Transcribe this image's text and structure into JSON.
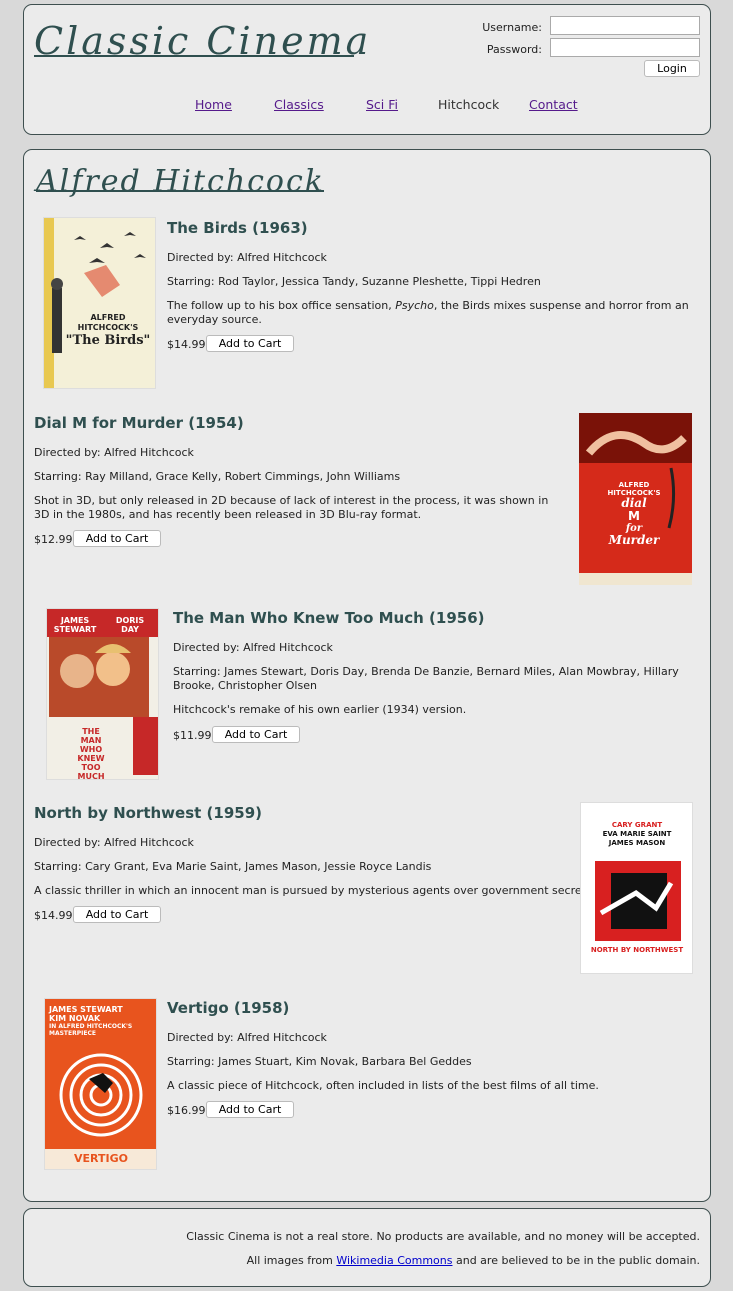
{
  "site": {
    "logo": "Classic Cinema"
  },
  "login": {
    "username_label": "Username:",
    "password_label": "Password:",
    "username_value": "",
    "password_value": "",
    "button": "Login"
  },
  "nav": {
    "home": "Home",
    "classics": "Classics",
    "scifi": "Sci Fi",
    "hitchcock": "Hitchcock",
    "contact": "Contact"
  },
  "section": {
    "title": "Alfred Hitchcock"
  },
  "movies": [
    {
      "title": "The Birds (1963)",
      "director": "Directed by: Alfred Hitchcock",
      "starring": "Starring: Rod Taylor, Jessica Tandy, Suzanne Pleshette, Tippi Hedren",
      "desc_before": "The follow up to his box office sensation, ",
      "desc_em": "Psycho",
      "desc_after": ", the Birds mixes suspense and horror from an everyday source.",
      "price": "$14.99",
      "button": "Add to Cart",
      "poster_text": [
        "ALFRED",
        "HITCHCOCK'S",
        "\"The Birds\""
      ]
    },
    {
      "title": "Dial M for Murder (1954)",
      "director": "Directed by: Alfred Hitchcock",
      "starring": "Starring: Ray Milland, Grace Kelly, Robert Cimmings, John Williams",
      "desc": "Shot in 3D, but only released in 2D because of lack of interest in the process, it was shown in 3D in the 1980s, and has recently been released in 3D Blu-ray format.",
      "price": "$12.99",
      "button": "Add to Cart",
      "poster_text": [
        "ALFRED",
        "HITCHCOCK'S",
        "dial",
        "M",
        "for",
        "Murder"
      ]
    },
    {
      "title": "The Man Who Knew Too Much (1956)",
      "director": "Directed by: Alfred Hitchcock",
      "starring": "Starring: James Stewart, Doris Day, Brenda De Banzie, Bernard Miles, Alan Mowbray, Hillary Brooke, Christopher Olsen",
      "desc": "Hitchcock's remake of his own earlier (1934) version.",
      "price": "$11.99",
      "button": "Add to Cart",
      "poster_text": [
        "JAMES",
        "STEWART",
        "DORIS",
        "DAY",
        "THE",
        "MAN",
        "WHO",
        "KNEW",
        "TOO",
        "MUCH"
      ]
    },
    {
      "title": "North by Northwest (1959)",
      "director": "Directed by: Alfred Hitchcock",
      "starring": "Starring: Cary Grant, Eva Marie Saint, James Mason, Jessie Royce Landis",
      "desc": "A classic thriller in which an innocent man is pursued by mysterious agents over government secrets.",
      "price": "$14.99",
      "button": "Add to Cart",
      "poster_text": [
        "CARY GRANT",
        "EVA MARIE SAINT",
        "JAMES MASON",
        "NORTH BY NORTHWEST"
      ]
    },
    {
      "title": "Vertigo (1958)",
      "director": "Directed by: Alfred Hitchcock",
      "starring": "Starring: James Stuart, Kim Novak, Barbara Bel Geddes",
      "desc": "A classic piece of Hitchcock, often included in lists of the best films of all time.",
      "price": "$16.99",
      "button": "Add to Cart",
      "poster_text": [
        "JAMES STEWART",
        "KIM NOVAK",
        "IN ALFRED HITCHCOCK'S",
        "MASTERPIECE",
        "VERTIGO"
      ]
    }
  ],
  "footer": {
    "line1": "Classic Cinema is not a real store. No products are available, and no money will be accepted.",
    "line2_before": "All images from ",
    "line2_link": "Wikimedia Commons",
    "line2_after": " and are believed to be in the public domain."
  },
  "colors": {
    "heading": "#2f4f4f",
    "panel_bg": "#ebebeb",
    "page_bg": "#d9d9d9",
    "visited_link": "#551a8b",
    "link": "#0000cc"
  }
}
